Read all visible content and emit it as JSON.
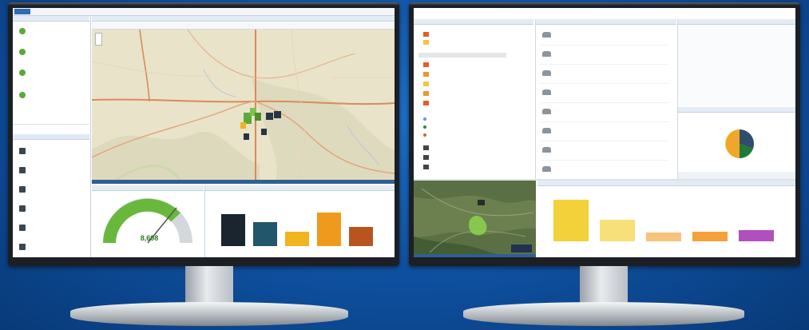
{
  "left_monitor": {
    "window_title": "",
    "gauge": {
      "value_label": "8,608",
      "fraction": 0.82
    },
    "bar_chart": {
      "categories": [
        "",
        "",
        "",
        "",
        ""
      ],
      "values": [
        30,
        24,
        16,
        36,
        22
      ],
      "colors": [
        "#1a2530",
        "#21566b",
        "#f2b320",
        "#ef9a1c",
        "#b8551f"
      ]
    }
  },
  "right_monitor": {
    "bar_chart": {
      "categories": [
        "",
        "",
        "",
        "",
        ""
      ],
      "values": [
        42,
        22,
        9,
        10,
        12
      ],
      "colors": [
        "#f3d13a",
        "#f7e07a",
        "#f7c27a",
        "#f3a23a",
        "#b24fbf"
      ]
    },
    "pie": {
      "values": [
        40,
        30,
        18,
        12
      ],
      "colors": [
        "#f0a629",
        "#2f4e6a",
        "#1f7a3a",
        "#ffd34d"
      ]
    },
    "legend_colors": [
      "#e55d2b",
      "#e89a2d",
      "#f3c63c",
      "#5a9bd6",
      "#3d7f3d",
      "#9b59b6"
    ]
  }
}
